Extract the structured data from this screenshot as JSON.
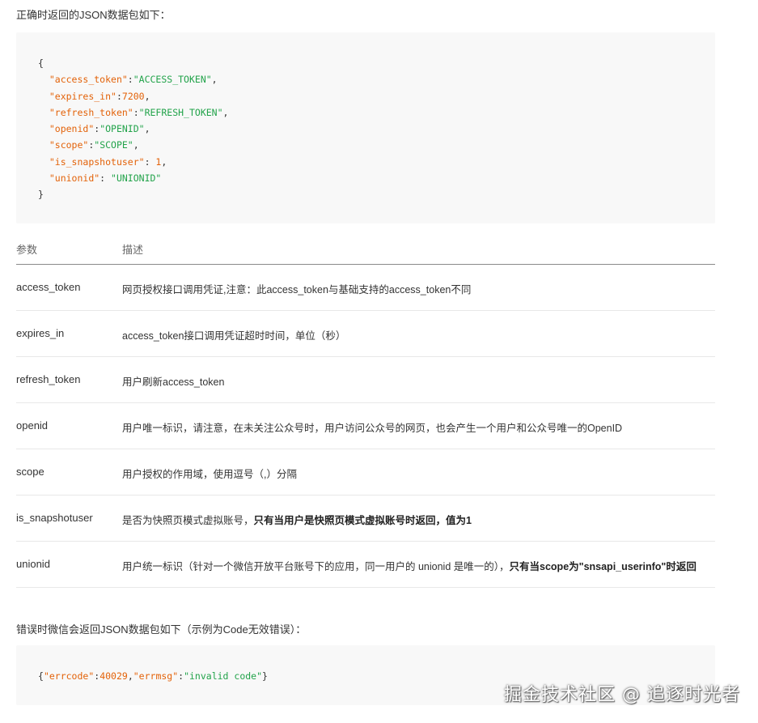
{
  "intro": "正确时返回的JSON数据包如下：",
  "json_lines": {
    "open": "{",
    "l1": {
      "k": "\"access_token\"",
      "sep": ":",
      "v": "\"ACCESS_TOKEN\"",
      "end": ","
    },
    "l2": {
      "k": "\"expires_in\"",
      "sep": ":",
      "v": "7200",
      "end": ","
    },
    "l3": {
      "k": "\"refresh_token\"",
      "sep": ":",
      "v": "\"REFRESH_TOKEN\"",
      "end": ","
    },
    "l4": {
      "k": "\"openid\"",
      "sep": ":",
      "v": "\"OPENID\"",
      "end": ","
    },
    "l5": {
      "k": "\"scope\"",
      "sep": ":",
      "v": "\"SCOPE\"",
      "end": ","
    },
    "l6": {
      "k": "\"is_snapshotuser\"",
      "sep": ": ",
      "v": "1",
      "end": ","
    },
    "l7": {
      "k": "\"unionid\"",
      "sep": ": ",
      "v": "\"UNIONID\"",
      "end": ""
    },
    "close": "}"
  },
  "table": {
    "headers": [
      "参数",
      "描述"
    ],
    "rows": [
      {
        "param": "access_token",
        "desc": "网页授权接口调用凭证,注意：此access_token与基础支持的access_token不同"
      },
      {
        "param": "expires_in",
        "desc": "access_token接口调用凭证超时时间，单位（秒）"
      },
      {
        "param": "refresh_token",
        "desc": "用户刷新access_token"
      },
      {
        "param": "openid",
        "desc": "用户唯一标识，请注意，在未关注公众号时，用户访问公众号的网页，也会产生一个用户和公众号唯一的OpenID"
      },
      {
        "param": "scope",
        "desc": "用户授权的作用域，使用逗号（,）分隔"
      },
      {
        "param": "is_snapshotuser",
        "desc": "是否为快照页模式虚拟账号，",
        "bold": "只有当用户是快照页模式虚拟账号时返回，值为1"
      },
      {
        "param": "unionid",
        "desc": "用户统一标识（针对一个微信开放平台账号下的应用，同一用户的 unionid 是唯一的），",
        "bold": "只有当scope为\"snsapi_userinfo\"时返回"
      }
    ]
  },
  "outro": "错误时微信会返回JSON数据包如下（示例为Code无效错误）：",
  "error_json": {
    "open": "{",
    "k1": "\"errcode\"",
    "sep1": ":",
    "v1": "40029",
    "comma": ",",
    "k2": "\"errmsg\"",
    "sep2": ":",
    "v2": "\"invalid code\"",
    "close": "}"
  },
  "watermark": "掘金技术社区 @ 追逐时光者"
}
